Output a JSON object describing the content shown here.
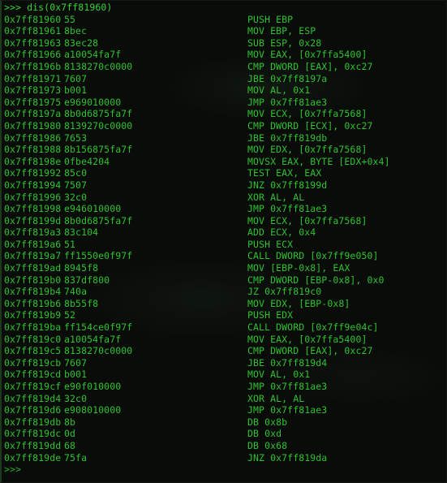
{
  "terminal": {
    "prompt_symbol": ">>>",
    "command": ">>> dis(0x7ff81960)",
    "trailing_prompt": ">>>",
    "colors": {
      "background": "#0a0c0a",
      "text_green": "#2fc22f",
      "bright_green": "#35d435",
      "border": "#1e3a1e"
    },
    "columns": [
      "address",
      "bytes",
      "instruction"
    ],
    "listing": [
      {
        "address": "0x7ff81960",
        "bytes": "55",
        "instruction": "PUSH EBP"
      },
      {
        "address": "0x7ff81961",
        "bytes": "8bec",
        "instruction": "MOV EBP, ESP"
      },
      {
        "address": "0x7ff81963",
        "bytes": "83ec28",
        "instruction": "SUB ESP, 0x28"
      },
      {
        "address": "0x7ff81966",
        "bytes": "a10054fa7f",
        "instruction": "MOV EAX, [0x7ffa5400]"
      },
      {
        "address": "0x7ff8196b",
        "bytes": "8138270c0000",
        "instruction": "CMP DWORD [EAX], 0xc27"
      },
      {
        "address": "0x7ff81971",
        "bytes": "7607",
        "instruction": "JBE 0x7ff8197a"
      },
      {
        "address": "0x7ff81973",
        "bytes": "b001",
        "instruction": "MOV AL, 0x1"
      },
      {
        "address": "0x7ff81975",
        "bytes": "e969010000",
        "instruction": "JMP 0x7ff81ae3"
      },
      {
        "address": "0x7ff8197a",
        "bytes": "8b0d6875fa7f",
        "instruction": "MOV ECX, [0x7ffa7568]"
      },
      {
        "address": "0x7ff81980",
        "bytes": "8139270c0000",
        "instruction": "CMP DWORD [ECX], 0xc27"
      },
      {
        "address": "0x7ff81986",
        "bytes": "7653",
        "instruction": "JBE 0x7ff819db"
      },
      {
        "address": "0x7ff81988",
        "bytes": "8b156875fa7f",
        "instruction": "MOV EDX, [0x7ffa7568]"
      },
      {
        "address": "0x7ff8198e",
        "bytes": "0fbe4204",
        "instruction": "MOVSX EAX, BYTE [EDX+0x4]"
      },
      {
        "address": "0x7ff81992",
        "bytes": "85c0",
        "instruction": "TEST EAX, EAX"
      },
      {
        "address": "0x7ff81994",
        "bytes": "7507",
        "instruction": "JNZ 0x7ff8199d"
      },
      {
        "address": "0x7ff81996",
        "bytes": "32c0",
        "instruction": "XOR AL, AL"
      },
      {
        "address": "0x7ff81998",
        "bytes": "e946010000",
        "instruction": "JMP 0x7ff81ae3"
      },
      {
        "address": "0x7ff8199d",
        "bytes": "8b0d6875fa7f",
        "instruction": "MOV ECX, [0x7ffa7568]"
      },
      {
        "address": "0x7ff819a3",
        "bytes": "83c104",
        "instruction": "ADD ECX, 0x4"
      },
      {
        "address": "0x7ff819a6",
        "bytes": "51",
        "instruction": "PUSH ECX"
      },
      {
        "address": "0x7ff819a7",
        "bytes": "ff1550e0f97f",
        "instruction": "CALL DWORD [0x7ff9e050]"
      },
      {
        "address": "0x7ff819ad",
        "bytes": "8945f8",
        "instruction": "MOV [EBP-0x8], EAX"
      },
      {
        "address": "0x7ff819b0",
        "bytes": "837df800",
        "instruction": "CMP DWORD [EBP-0x8], 0x0"
      },
      {
        "address": "0x7ff819b4",
        "bytes": "740a",
        "instruction": "JZ 0x7ff819c0"
      },
      {
        "address": "0x7ff819b6",
        "bytes": "8b55f8",
        "instruction": "MOV EDX, [EBP-0x8]"
      },
      {
        "address": "0x7ff819b9",
        "bytes": "52",
        "instruction": "PUSH EDX"
      },
      {
        "address": "0x7ff819ba",
        "bytes": "ff154ce0f97f",
        "instruction": "CALL DWORD [0x7ff9e04c]"
      },
      {
        "address": "0x7ff819c0",
        "bytes": "a10054fa7f",
        "instruction": "MOV EAX, [0x7ffa5400]"
      },
      {
        "address": "0x7ff819c5",
        "bytes": "8138270c0000",
        "instruction": "CMP DWORD [EAX], 0xc27"
      },
      {
        "address": "0x7ff819cb",
        "bytes": "7607",
        "instruction": "JBE 0x7ff819d4"
      },
      {
        "address": "0x7ff819cd",
        "bytes": "b001",
        "instruction": "MOV AL, 0x1"
      },
      {
        "address": "0x7ff819cf",
        "bytes": "e90f010000",
        "instruction": "JMP 0x7ff81ae3"
      },
      {
        "address": "0x7ff819d4",
        "bytes": "32c0",
        "instruction": "XOR AL, AL"
      },
      {
        "address": "0x7ff819d6",
        "bytes": "e908010000",
        "instruction": "JMP 0x7ff81ae3"
      },
      {
        "address": "0x7ff819db",
        "bytes": "8b",
        "instruction": "DB 0x8b"
      },
      {
        "address": "0x7ff819dc",
        "bytes": "0d",
        "instruction": "DB 0xd"
      },
      {
        "address": "0x7ff819dd",
        "bytes": "68",
        "instruction": "DB 0x68"
      },
      {
        "address": "0x7ff819de",
        "bytes": "75fa",
        "instruction": "JNZ 0x7ff819da"
      }
    ]
  }
}
